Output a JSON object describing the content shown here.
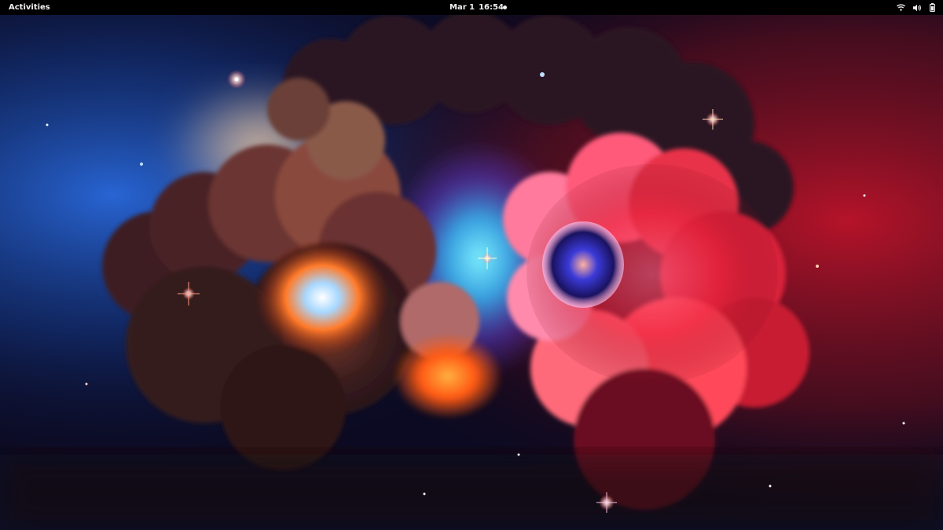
{
  "top_bar": {
    "activities_label": "Activities",
    "clock": {
      "date": "Mar 1",
      "time": "16:54"
    },
    "status_icons": [
      "wifi-icon",
      "volume-icon",
      "battery-icon"
    ]
  },
  "wallpaper": {
    "description_colors": {
      "space_dark": "#0a0e2a",
      "nebula_blue": "#2f7bff",
      "nebula_cyan": "#37d0ff",
      "nebula_orange": "#ff6a1a",
      "nebula_red": "#e8203a",
      "nebula_pink": "#ff5a8c",
      "cloud_brown": "#4a2a2a"
    }
  },
  "colors": {
    "top_bar_bg": "#000000",
    "top_bar_text": "#f2f2f2"
  }
}
